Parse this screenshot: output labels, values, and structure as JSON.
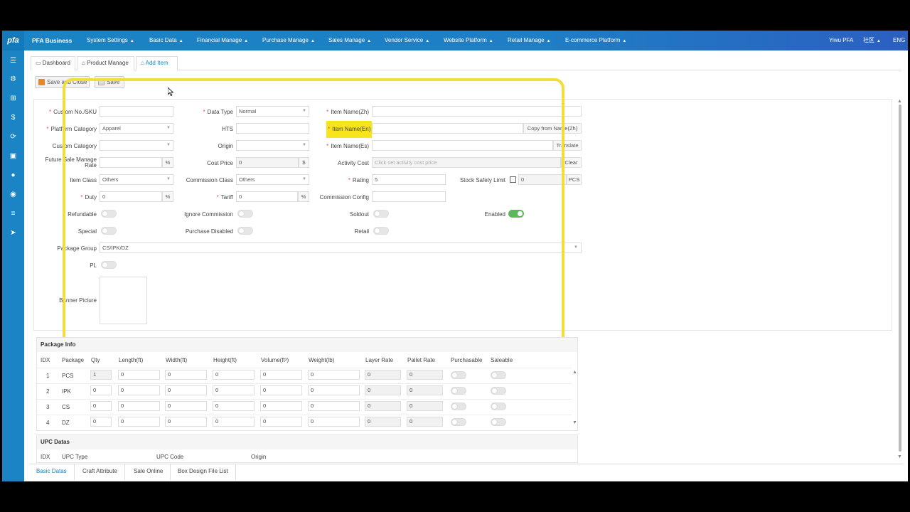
{
  "topbar": {
    "logo": "pfa",
    "brand": "PFA Business",
    "menus": [
      "System Settings",
      "Basic Data",
      "Financial Manage",
      "Purchase Manage",
      "Sales Manage",
      "Vendor Service",
      "Website Platform",
      "Retail Manage",
      "E-commerce Platform"
    ],
    "user": "Yiwu PFA",
    "lang_zh": "社区",
    "lang_en": "ENG"
  },
  "sidebar_icons": [
    "list-icon",
    "gear-icon",
    "sitemap-icon",
    "dollar-icon",
    "refresh-icon",
    "money-icon",
    "user-icon",
    "globe-icon",
    "bars-icon",
    "send-icon"
  ],
  "tabs": [
    "Dashboard",
    "Product Manage",
    "Add Item"
  ],
  "toolbar": {
    "save_close": "Save and Close",
    "save": "Save"
  },
  "form": {
    "custom_no": "Custom No./SKU",
    "data_type": "Data Type",
    "data_type_val": "Normal",
    "item_name_zh": "Item Name(Zh)",
    "platform_category": "Platform Category",
    "platform_category_val": "Apparel",
    "hts": "HTS",
    "item_name_en": "Item Name(En)",
    "copy_from": "Copy from Name(Zh)",
    "custom_category": "Custom Category",
    "origin": "Origin",
    "item_name_es": "Item Name(Es)",
    "translate": "Translate",
    "future_sale_1": "Future Sale Manage",
    "future_sale_2": "Rate",
    "pct": "%",
    "cost_price": "Cost Price",
    "cost_price_val": "0",
    "dollar": "$",
    "activity_cost": "Activity Cost",
    "activity_cost_ph": "Click set activity cost price",
    "clear": "Clear",
    "item_class": "Item Class",
    "item_class_val": "Others",
    "commission_class": "Commission Class",
    "commission_class_val": "Others",
    "rating": "Rating",
    "rating_val": "5",
    "stock_safety": "Stock Safety Limit",
    "stock_safety_val": "0",
    "pcs": "PCS",
    "duty": "Duty",
    "duty_val": "0",
    "tariff": "Tariff",
    "tariff_val": "0",
    "commission_config": "Commission Config",
    "refundable": "Refundable",
    "ignore_commission": "Ignore Commission",
    "soldout": "Soldout",
    "enabled": "Enabled",
    "special": "Special",
    "purchase_disabled": "Purchase Disabled",
    "retail": "Retail",
    "package_group": "Package Group",
    "package_group_val": "CS/IPK/DZ",
    "pl": "PL",
    "banner_picture": "Banner Picture"
  },
  "package_info": {
    "title": "Package Info",
    "columns": [
      "IDX",
      "Package",
      "Qty",
      "Length(ft)",
      "Width(ft)",
      "Height(ft)",
      "Volume(ft³)",
      "Weight(lb)",
      "Layer Rate",
      "Pallet Rate",
      "Purchasable",
      "Saleable"
    ],
    "rows": [
      {
        "idx": "1",
        "package": "PCS",
        "qty": "1",
        "length": "0",
        "width": "0",
        "height": "0",
        "volume": "0",
        "weight": "0",
        "layer": "0",
        "pallet": "0"
      },
      {
        "idx": "2",
        "package": "IPK",
        "qty": "0",
        "length": "0",
        "width": "0",
        "height": "0",
        "volume": "0",
        "weight": "0",
        "layer": "0",
        "pallet": "0"
      },
      {
        "idx": "3",
        "package": "CS",
        "qty": "0",
        "length": "0",
        "width": "0",
        "height": "0",
        "volume": "0",
        "weight": "0",
        "layer": "0",
        "pallet": "0"
      },
      {
        "idx": "4",
        "package": "DZ",
        "qty": "0",
        "length": "0",
        "width": "0",
        "height": "0",
        "volume": "0",
        "weight": "0",
        "layer": "0",
        "pallet": "0"
      }
    ]
  },
  "upc_datas": {
    "title": "UPC Datas",
    "columns": [
      "IDX",
      "UPC Type",
      "UPC Code",
      "Origin"
    ]
  },
  "bottom_tabs": [
    "Basic Datas",
    "Craft Attribute",
    "Sale Online",
    "Box Design File List"
  ],
  "colors": {
    "primary": "#1a84c4",
    "highlight": "#f7e41a",
    "toggle_on": "#5cb85c"
  }
}
